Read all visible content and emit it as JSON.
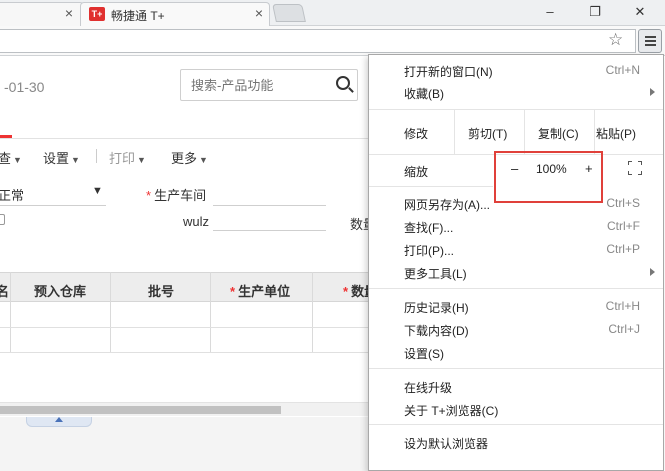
{
  "tabs": [
    {
      "title": "",
      "close": "×"
    },
    {
      "title": "畅捷通 T+",
      "favicon": "T+",
      "close": "×"
    }
  ],
  "window_controls": {
    "minimize": "–",
    "maximize": "❐",
    "close": "✕"
  },
  "page": {
    "date_text": "-01-30",
    "search": {
      "placeholder": "搜索-产品功能"
    },
    "actions": [
      {
        "label": "查"
      },
      {
        "label": "设置"
      },
      {
        "label": "打印"
      },
      {
        "label": "更多"
      }
    ],
    "form": {
      "status_value": "正常",
      "production_workshop_label": "生产车间",
      "wulz_label": "wulz",
      "quantity_label_partial": "数量"
    },
    "grid": {
      "columns": [
        "名",
        "预入仓库",
        "批号",
        "生产单位",
        "数量"
      ]
    }
  },
  "menu": {
    "new_window": {
      "label": "打开新的窗口(N)",
      "shortcut": "Ctrl+N"
    },
    "bookmarks": {
      "label": "收藏(B)"
    },
    "edit": {
      "label": "修改",
      "cut": "剪切(T)",
      "copy": "复制(C)",
      "paste": "粘贴(P)"
    },
    "zoom": {
      "label": "缩放",
      "minus": "–",
      "value": "100%",
      "plus": "+"
    },
    "save_page": {
      "label": "网页另存为(A)...",
      "shortcut": "Ctrl+S"
    },
    "find": {
      "label": "查找(F)...",
      "shortcut": "Ctrl+F"
    },
    "print": {
      "label": "打印(P)...",
      "shortcut": "Ctrl+P"
    },
    "more_tools": {
      "label": "更多工具(L)"
    },
    "history": {
      "label": "历史记录(H)",
      "shortcut": "Ctrl+H"
    },
    "downloads": {
      "label": "下载内容(D)",
      "shortcut": "Ctrl+J"
    },
    "settings": {
      "label": "设置(S)"
    },
    "online_upgrade": {
      "label": "在线升级"
    },
    "about": {
      "label": "关于 T+浏览器(C)"
    },
    "set_default": {
      "label": "设为默认浏览器"
    }
  },
  "colors": {
    "highlight_red": "#e0403a",
    "brand_red": "#e0302f"
  }
}
